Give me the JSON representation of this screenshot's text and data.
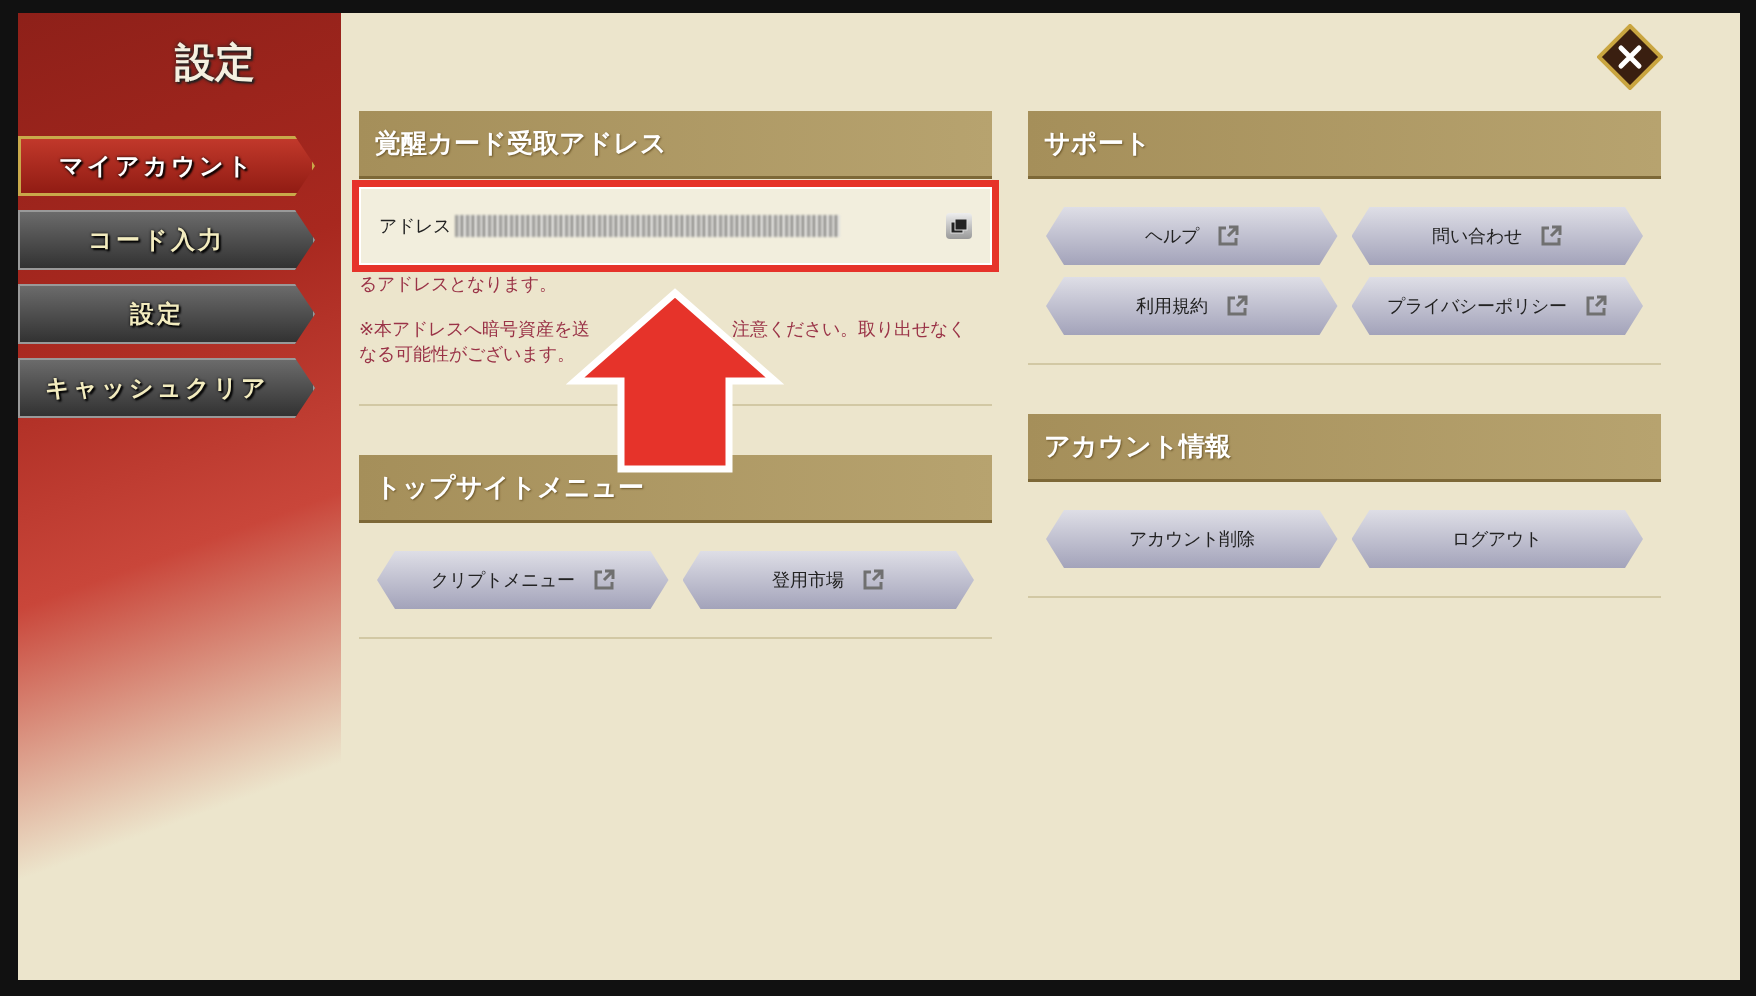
{
  "sidebar": {
    "title": "設定",
    "tabs": [
      {
        "label": "マイアカウント",
        "selected": true
      },
      {
        "label": "コード入力",
        "selected": false
      },
      {
        "label": "設定",
        "selected": false
      },
      {
        "label": "キャッシュクリア",
        "selected": false
      }
    ]
  },
  "columns": [
    [
      {
        "kind": "address",
        "title": "覚醒カード受取アドレス",
        "field_label": "アドレス",
        "notes": [
          [
            "るアドレスとなります。"
          ],
          [
            "※本アドレスへ暗号資産を送",
            "注意ください。取り出せなく"
          ],
          [
            "なる可能性がございます。"
          ]
        ]
      },
      {
        "kind": "buttons",
        "title": "トップサイトメニュー",
        "buttons": [
          {
            "label": "クリプトメニュー",
            "kind": "external"
          },
          {
            "label": "登用市場",
            "kind": "external"
          }
        ]
      }
    ],
    [
      {
        "kind": "buttons",
        "title": "サポート",
        "buttons": [
          {
            "label": "ヘルプ",
            "kind": "external"
          },
          {
            "label": "問い合わせ",
            "kind": "external"
          },
          {
            "label": "利用規約",
            "kind": "external"
          },
          {
            "label": "プライバシーポリシー",
            "kind": "external"
          }
        ]
      },
      {
        "kind": "buttons",
        "title": "アカウント情報",
        "buttons": [
          {
            "label": "アカウント削除",
            "kind": "plain"
          },
          {
            "label": "ログアウト",
            "kind": "plain"
          }
        ]
      }
    ]
  ]
}
